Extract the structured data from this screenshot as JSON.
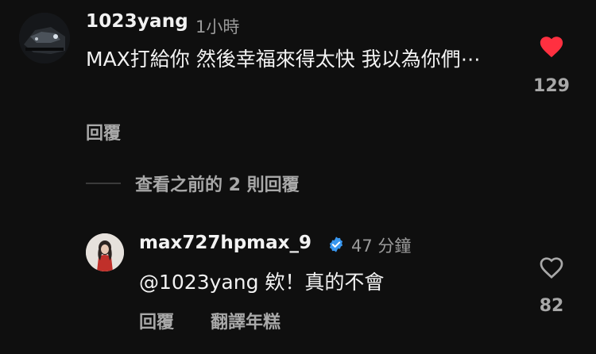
{
  "comment": {
    "username": "1023yang",
    "time": "1小時",
    "text": "MAX打給你 然後幸福來得太快 我以為你們⋯",
    "reply_label": "回覆",
    "like_count": "129",
    "liked": true,
    "like_color": "#ff3040"
  },
  "view_previous": {
    "label": "查看之前的 2 則回覆"
  },
  "reply": {
    "username": "max727hpmax_9",
    "verified": true,
    "verified_color": "#3897f0",
    "time": "47 分鐘",
    "text": "@1023yang 欸！真的不會",
    "reply_label": "回覆",
    "translate_label": "翻譯年糕",
    "like_count": "82",
    "liked": false
  }
}
